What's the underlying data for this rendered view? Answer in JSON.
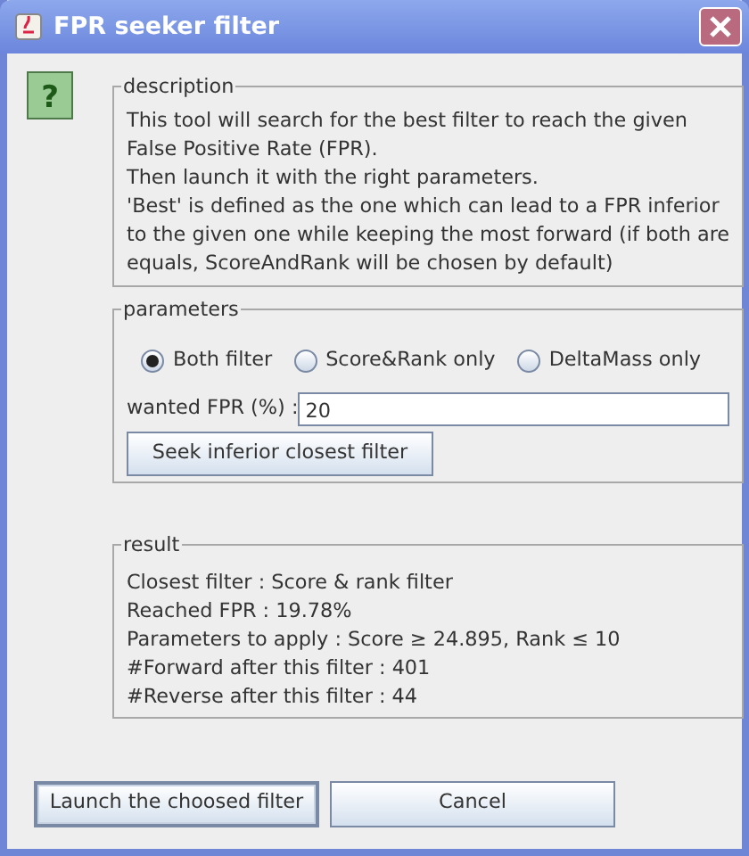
{
  "window": {
    "title": "FPR seeker filter"
  },
  "help_icon": "?",
  "description": {
    "legend": "description",
    "lines": [
      "This tool will search for the best filter to reach the given",
      "False Positive Rate (FPR).",
      "Then launch it with the right parameters.",
      "'Best' is defined as the one which can lead to a FPR inferior",
      "to the given one while keeping the most forward (if both are",
      "equals, ScoreAndRank will be chosen by default)"
    ]
  },
  "parameters": {
    "legend": "parameters",
    "options": [
      {
        "label": "Both filter",
        "selected": true
      },
      {
        "label": "Score&Rank only",
        "selected": false
      },
      {
        "label": "DeltaMass only",
        "selected": false
      }
    ],
    "fpr_label": "wanted FPR (%) :",
    "fpr_value": "20",
    "seek_button": "Seek inferior closest filter"
  },
  "result": {
    "legend": "result",
    "lines": [
      "Closest filter : Score & rank filter",
      "Reached FPR : 19.78%",
      "Parameters to apply : Score ≥ 24.895, Rank ≤ 10",
      "#Forward after this filter : 401",
      "#Reverse after this filter : 44"
    ]
  },
  "buttons": [
    {
      "label": "Launch the choosed filter",
      "focused": true
    },
    {
      "label": "Cancel",
      "focused": false
    }
  ]
}
